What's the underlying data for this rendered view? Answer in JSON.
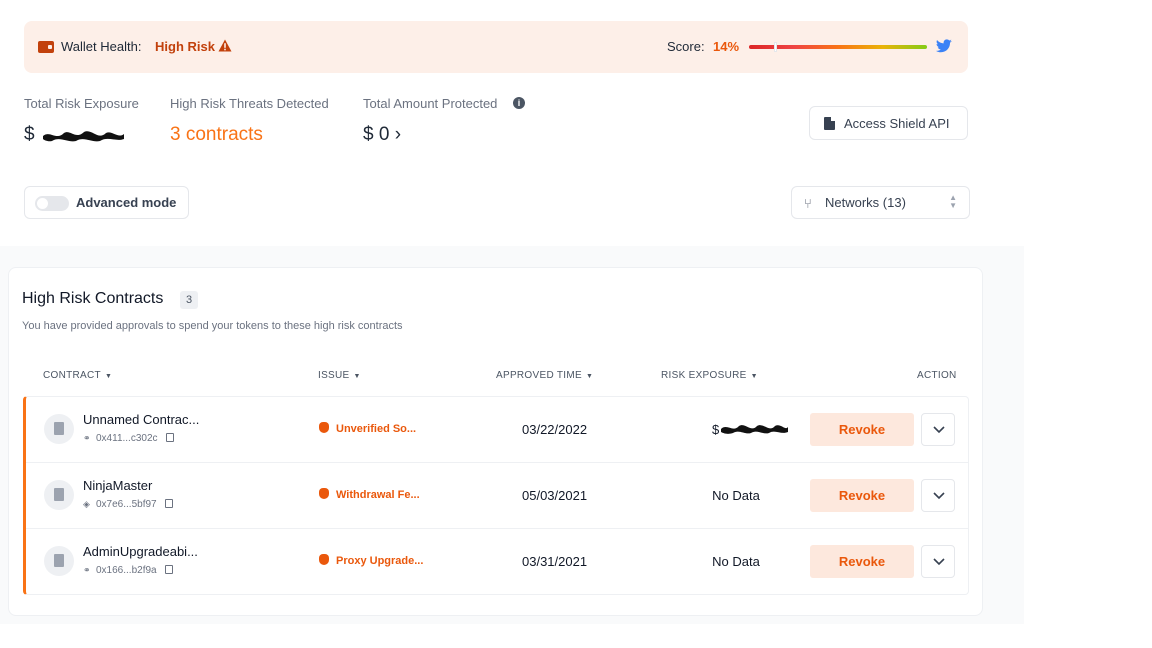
{
  "banner": {
    "health_label": "Wallet Health:",
    "health_value": "High Risk",
    "score_label": "Score:",
    "score_value": "14%",
    "score_fraction": 0.14,
    "colors": {
      "risk": "#c2410c",
      "score": "#ea580c",
      "banner_bg": "#fdefe8"
    },
    "icons": [
      "wallet-icon",
      "warning-icon",
      "twitter-icon"
    ]
  },
  "stats": {
    "exposure_label": "Total Risk Exposure",
    "exposure_currency": "$",
    "threats_label": "High Risk Threats Detected",
    "threats_value": "3 contracts",
    "protected_label": "Total Amount Protected",
    "protected_value": "$ 0 ›"
  },
  "shield_button": {
    "label": "Access Shield API"
  },
  "advanced_mode": {
    "label": "Advanced mode",
    "enabled": false
  },
  "networks": {
    "label": "Networks (13)"
  },
  "contracts_card": {
    "title": "High Risk Contracts",
    "count": "3",
    "subtitle": "You have provided approvals to spend your tokens to these high risk contracts",
    "columns": {
      "contract": "CONTRACT",
      "issue": "ISSUE",
      "approved": "APPROVED TIME",
      "exposure": "RISK EXPOSURE",
      "action": "ACTION"
    },
    "rows": [
      {
        "name": "Unnamed Contrac...",
        "address": "0x411...c302c",
        "chain_icon": "link-icon",
        "issue": "Unverified So...",
        "date": "03/22/2022",
        "exposure": "$",
        "action": "Revoke"
      },
      {
        "name": "NinjaMaster",
        "address": "0x7e6...5bf97",
        "chain_icon": "ethereum-icon",
        "issue": "Withdrawal Fe...",
        "date": "05/03/2021",
        "exposure": "No Data",
        "action": "Revoke"
      },
      {
        "name": "AdminUpgradeabi...",
        "address": "0x166...b2f9a",
        "chain_icon": "link-icon",
        "issue": "Proxy Upgrade...",
        "date": "03/31/2021",
        "exposure": "No Data",
        "action": "Revoke"
      }
    ]
  }
}
